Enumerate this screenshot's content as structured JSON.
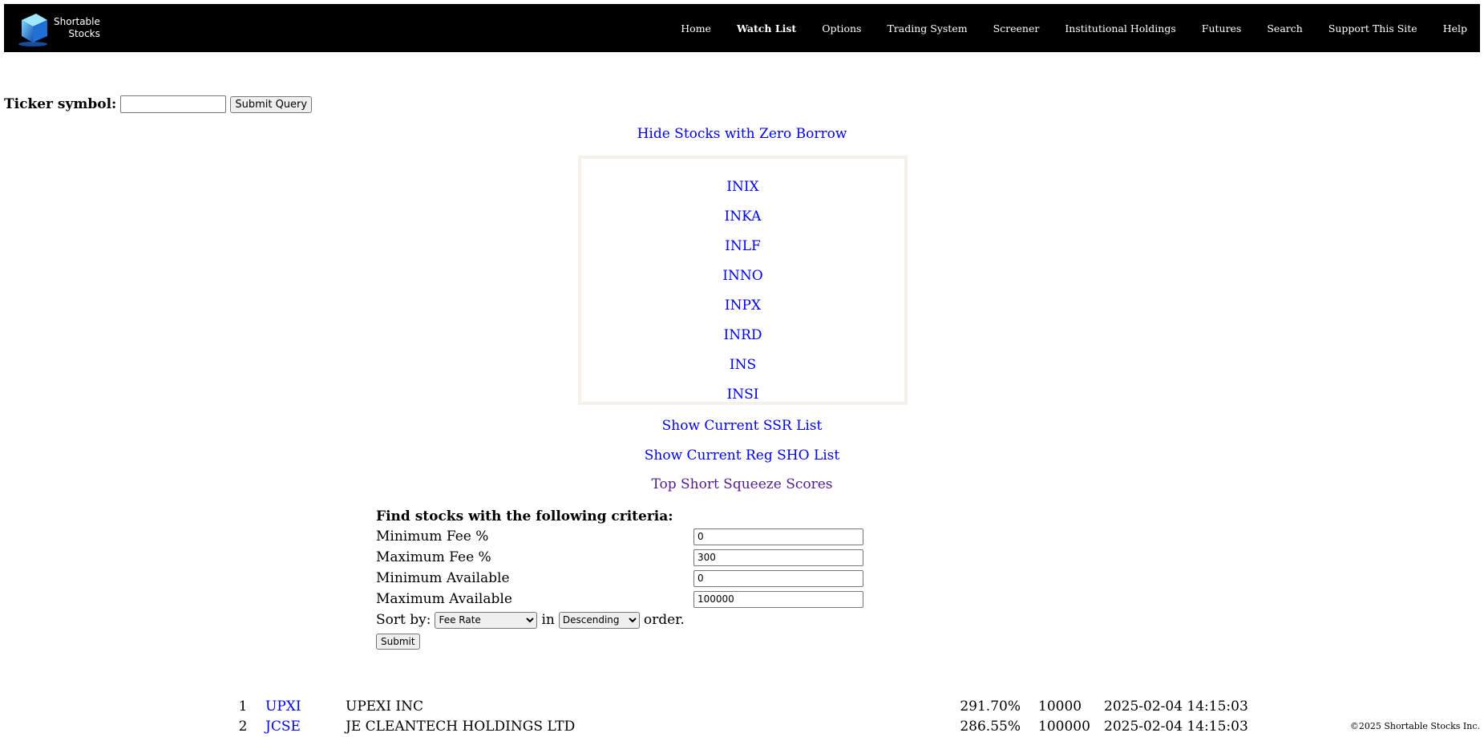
{
  "logo": {
    "line1": "Shortable",
    "line2": "Stocks"
  },
  "nav": {
    "items": [
      {
        "label": "Home"
      },
      {
        "label": "Watch List"
      },
      {
        "label": "Options"
      },
      {
        "label": "Trading System"
      },
      {
        "label": "Screener"
      },
      {
        "label": "Institutional Holdings"
      },
      {
        "label": "Futures"
      },
      {
        "label": "Search"
      },
      {
        "label": "Support This Site"
      },
      {
        "label": "Help"
      }
    ],
    "active": "Watch List"
  },
  "ticker_form": {
    "label": "Ticker symbol:",
    "value": "",
    "button": "Submit Query"
  },
  "links": {
    "hide_zero": "Hide Stocks with Zero Borrow",
    "ssr": "Show Current SSR List",
    "regsho": "Show Current Reg SHO List",
    "squeeze": "Top Short Squeeze Scores"
  },
  "ticker_list": [
    "INIX",
    "INKA",
    "INLF",
    "INNO",
    "INPX",
    "INRD",
    "INS",
    "INSI"
  ],
  "criteria": {
    "heading": "Find stocks with the following criteria:",
    "min_fee_label": "Minimum Fee %",
    "min_fee_value": "0",
    "max_fee_label": "Maximum Fee %",
    "max_fee_value": "300",
    "min_avail_label": "Minimum Available",
    "min_avail_value": "0",
    "max_avail_label": "Maximum Available",
    "max_avail_value": "100000",
    "sort_by_label": "Sort by:",
    "sort_by_value": "Fee Rate",
    "in_label": "in",
    "order_value": "Descending",
    "order_label": "order.",
    "submit": "Submit"
  },
  "results": [
    {
      "index": "1",
      "symbol": "UPXI",
      "name": "UPEXI INC",
      "fee": "291.70%",
      "available": "10000",
      "updated": "2025-02-04 14:15:03"
    },
    {
      "index": "2",
      "symbol": "JCSE",
      "name": "JE CLEANTECH HOLDINGS LTD",
      "fee": "286.55%",
      "available": "100000",
      "updated": "2025-02-04 14:15:03"
    }
  ],
  "copyright": "©2025 Shortable Stocks Inc."
}
